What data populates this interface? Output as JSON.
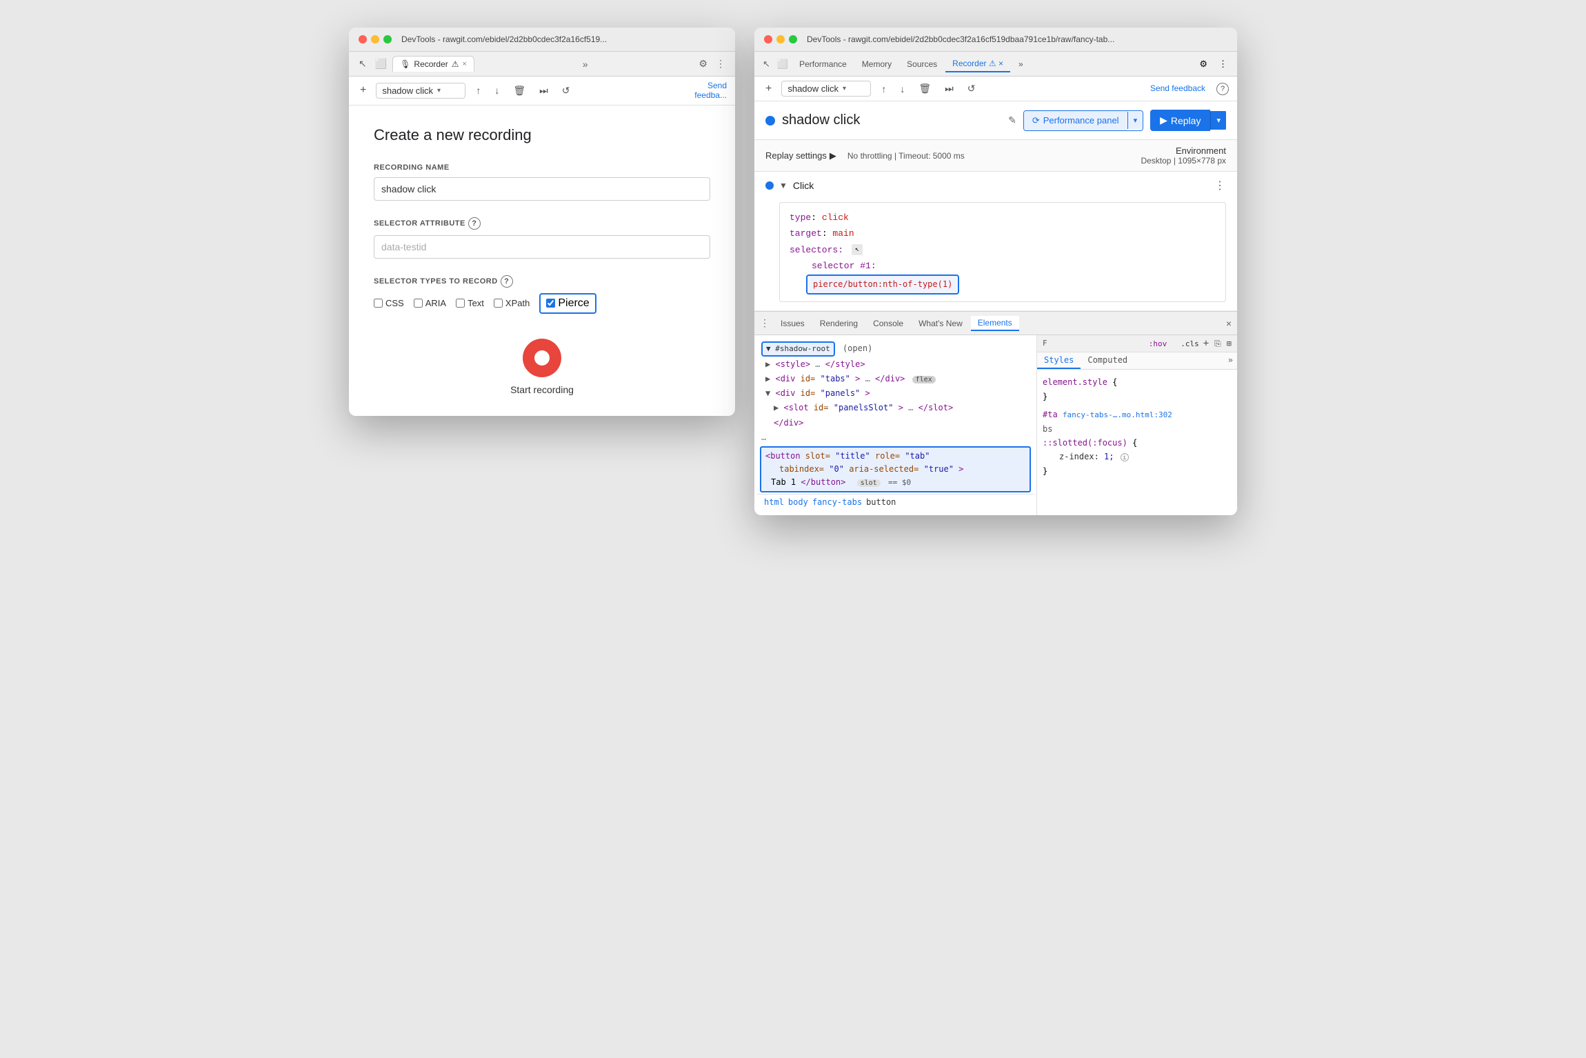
{
  "windows": {
    "left": {
      "titlebar": "DevTools - rawgit.com/ebidel/2d2bb0cdec3f2a16cf519...",
      "tab_label": "Recorder",
      "tab_icon": "🎙",
      "create_title": "Create a new recording",
      "recording_name_label": "RECORDING NAME",
      "recording_name_value": "shadow click",
      "selector_attribute_label": "SELECTOR ATTRIBUTE",
      "selector_attribute_placeholder": "data-testid",
      "selector_types_label": "SELECTOR TYPES TO RECORD",
      "selector_types": [
        {
          "label": "CSS",
          "checked": false
        },
        {
          "label": "ARIA",
          "checked": false
        },
        {
          "label": "Text",
          "checked": false
        },
        {
          "label": "XPath",
          "checked": false
        },
        {
          "label": "Pierce",
          "checked": true
        }
      ],
      "start_recording_label": "Start recording"
    },
    "right": {
      "titlebar": "DevTools - rawgit.com/ebidel/2d2bb0cdec3f2a16cf519dbaa791ce1b/raw/fancy-tab...",
      "tabs": [
        "Performance",
        "Memory",
        "Sources",
        "Recorder",
        ""
      ],
      "active_tab": "Recorder",
      "send_feedback": "Send feedback",
      "recording_name": "shadow click",
      "perf_panel_label": "Performance panel",
      "replay_label": "Replay",
      "replay_settings_label": "Replay settings",
      "throttling_label": "No throttling",
      "timeout_label": "Timeout: 5000 ms",
      "environment_label": "Environment",
      "environment_desktop": "Desktop",
      "environment_size": "1095×778 px",
      "step": {
        "name": "Click",
        "type": "type: click",
        "target": "target: main",
        "selectors_label": "selectors:",
        "selector1_label": "selector #1:",
        "selector1_value": "pierce/button:nth-of-type(1)"
      },
      "bottom_tabs": [
        "Issues",
        "Rendering",
        "Console",
        "What's New",
        "Elements"
      ],
      "active_bottom_tab": "Elements",
      "html_lines": [
        {
          "indent": 0,
          "content": "▼ #shadow-root",
          "type": "shadow-root",
          "suffix": "(open)"
        },
        {
          "indent": 1,
          "content": "  ▶ <style>…</style>",
          "type": "tag"
        },
        {
          "indent": 1,
          "content": "  ▶ <div id=\"tabs\">…</div>",
          "type": "tag",
          "badge": "flex"
        },
        {
          "indent": 1,
          "content": "  ▼ <div id=\"panels\">",
          "type": "tag"
        },
        {
          "indent": 2,
          "content": "    ▶ <slot id=\"panelsSlot\">…</slot>",
          "type": "tag"
        },
        {
          "indent": 2,
          "content": "    </div>",
          "type": "close"
        },
        {
          "indent": 0,
          "content": "…",
          "type": "ellipsis"
        }
      ],
      "selected_html": "<button slot=\"title\" role=\"tab\"\n    tabindex=\"0\" aria-selected=\"true\">\n    Tab 1</button>",
      "selected_hint": "slot",
      "selected_eq": "== $0",
      "breadcrumbs": [
        "html",
        "body",
        "fancy-tabs",
        "button"
      ],
      "styles": {
        "tabs": [
          "Styles",
          "Computed"
        ],
        "active_tab": "Styles",
        "filter_label": "F",
        "pseudo_label": ":hov",
        "cls_label": ".cls",
        "element_style": "element.style {",
        "element_style_close": "}",
        "rule_selector": "#ta",
        "rule_source": "fancy-tabs-….mo.html:302",
        "rule_suffix": "bs",
        "rule_pseudo": "::slotted(:focus) {",
        "rule_prop": "z-index:",
        "rule_val": "1;",
        "rule_info": true,
        "rule_close": "}"
      }
    }
  }
}
